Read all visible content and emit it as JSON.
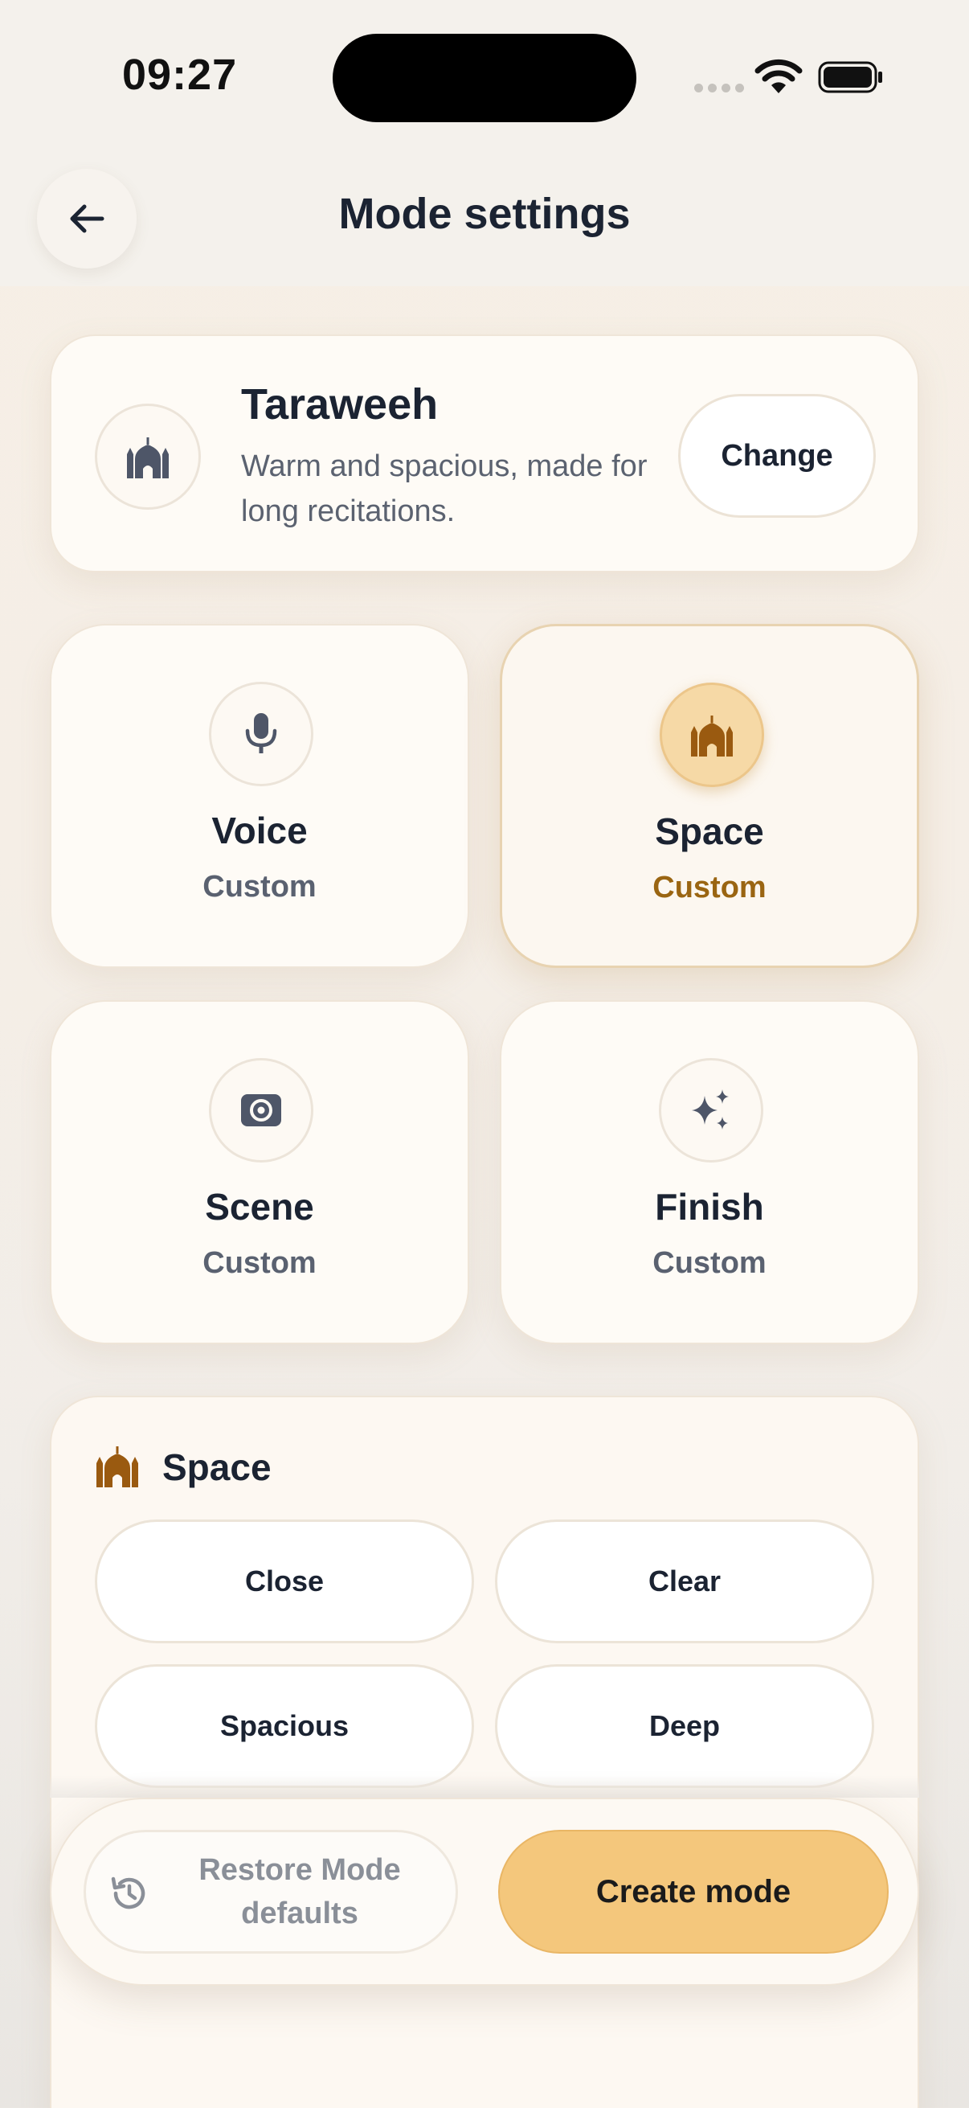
{
  "status": {
    "time": "09:27"
  },
  "header": {
    "title": "Mode settings"
  },
  "mode": {
    "name": "Taraweeh",
    "description": "Warm and spacious, made for long recitations.",
    "change_label": "Change"
  },
  "tiles": [
    {
      "title": "Voice",
      "subtitle": "Custom",
      "icon": "microphone-icon"
    },
    {
      "title": "Space",
      "subtitle": "Custom",
      "icon": "mosque-icon",
      "selected": true
    },
    {
      "title": "Scene",
      "subtitle": "Custom",
      "icon": "speaker-icon"
    },
    {
      "title": "Finish",
      "subtitle": "Custom",
      "icon": "sparkles-icon"
    }
  ],
  "space_panel": {
    "title": "Space",
    "options": [
      "Close",
      "Clear",
      "Spacious",
      "Deep"
    ]
  },
  "bottom": {
    "restore_label": "Restore Mode defaults",
    "create_label": "Create mode"
  },
  "colors": {
    "accent": "#f4c77c",
    "accent_dark": "#9a6512",
    "text_primary": "#1b2332",
    "text_secondary": "#5a6170"
  }
}
